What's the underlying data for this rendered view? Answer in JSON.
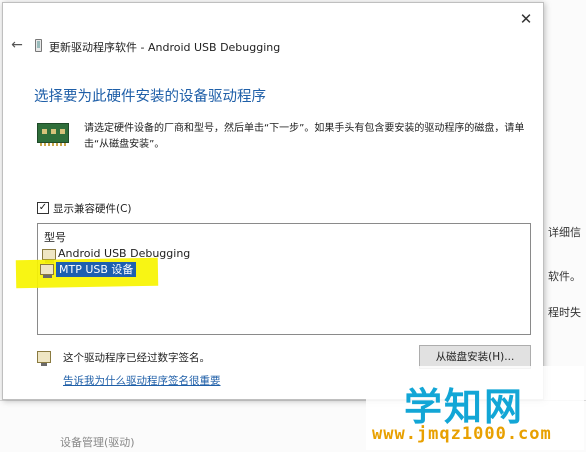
{
  "dialog": {
    "title": "更新驱动程序软件 - Android USB Debugging",
    "close_glyph": "✕",
    "back_glyph": "←",
    "heading": "选择要为此硬件安装的设备驱动程序",
    "instructions": "请选定硬件设备的厂商和型号，然后单击“下一步”。如果手头有包含要安装的驱动程序的磁盘，请单击“从磁盘安装”。",
    "show_compatible": {
      "label": "显示兼容硬件(C)",
      "checked": true,
      "check_glyph": "✓"
    },
    "model_list": {
      "header": "型号",
      "items": [
        {
          "label": "Android USB Debugging",
          "selected": false
        },
        {
          "label": "MTP USB 设备",
          "selected": true
        }
      ]
    },
    "signature_text": "这个驱动程序已经过数字签名。",
    "signature_link": "告诉我为什么驱动程序签名很重要",
    "have_disk_button": "从磁盘安装(H)..."
  },
  "background": {
    "right_fragments": [
      "详细信",
      "软件。",
      "程时失"
    ],
    "bottom_fragment": "设备管理(驱动)"
  },
  "watermark": {
    "title": "学知网",
    "url": "www.jmqz1000.com"
  },
  "colors": {
    "heading_blue": "#1f5fa8",
    "selection_blue": "#1d5fb0",
    "highlight_yellow": "#f7f400",
    "watermark_blue": "#12a6d6",
    "watermark_orange": "#e8a000"
  }
}
